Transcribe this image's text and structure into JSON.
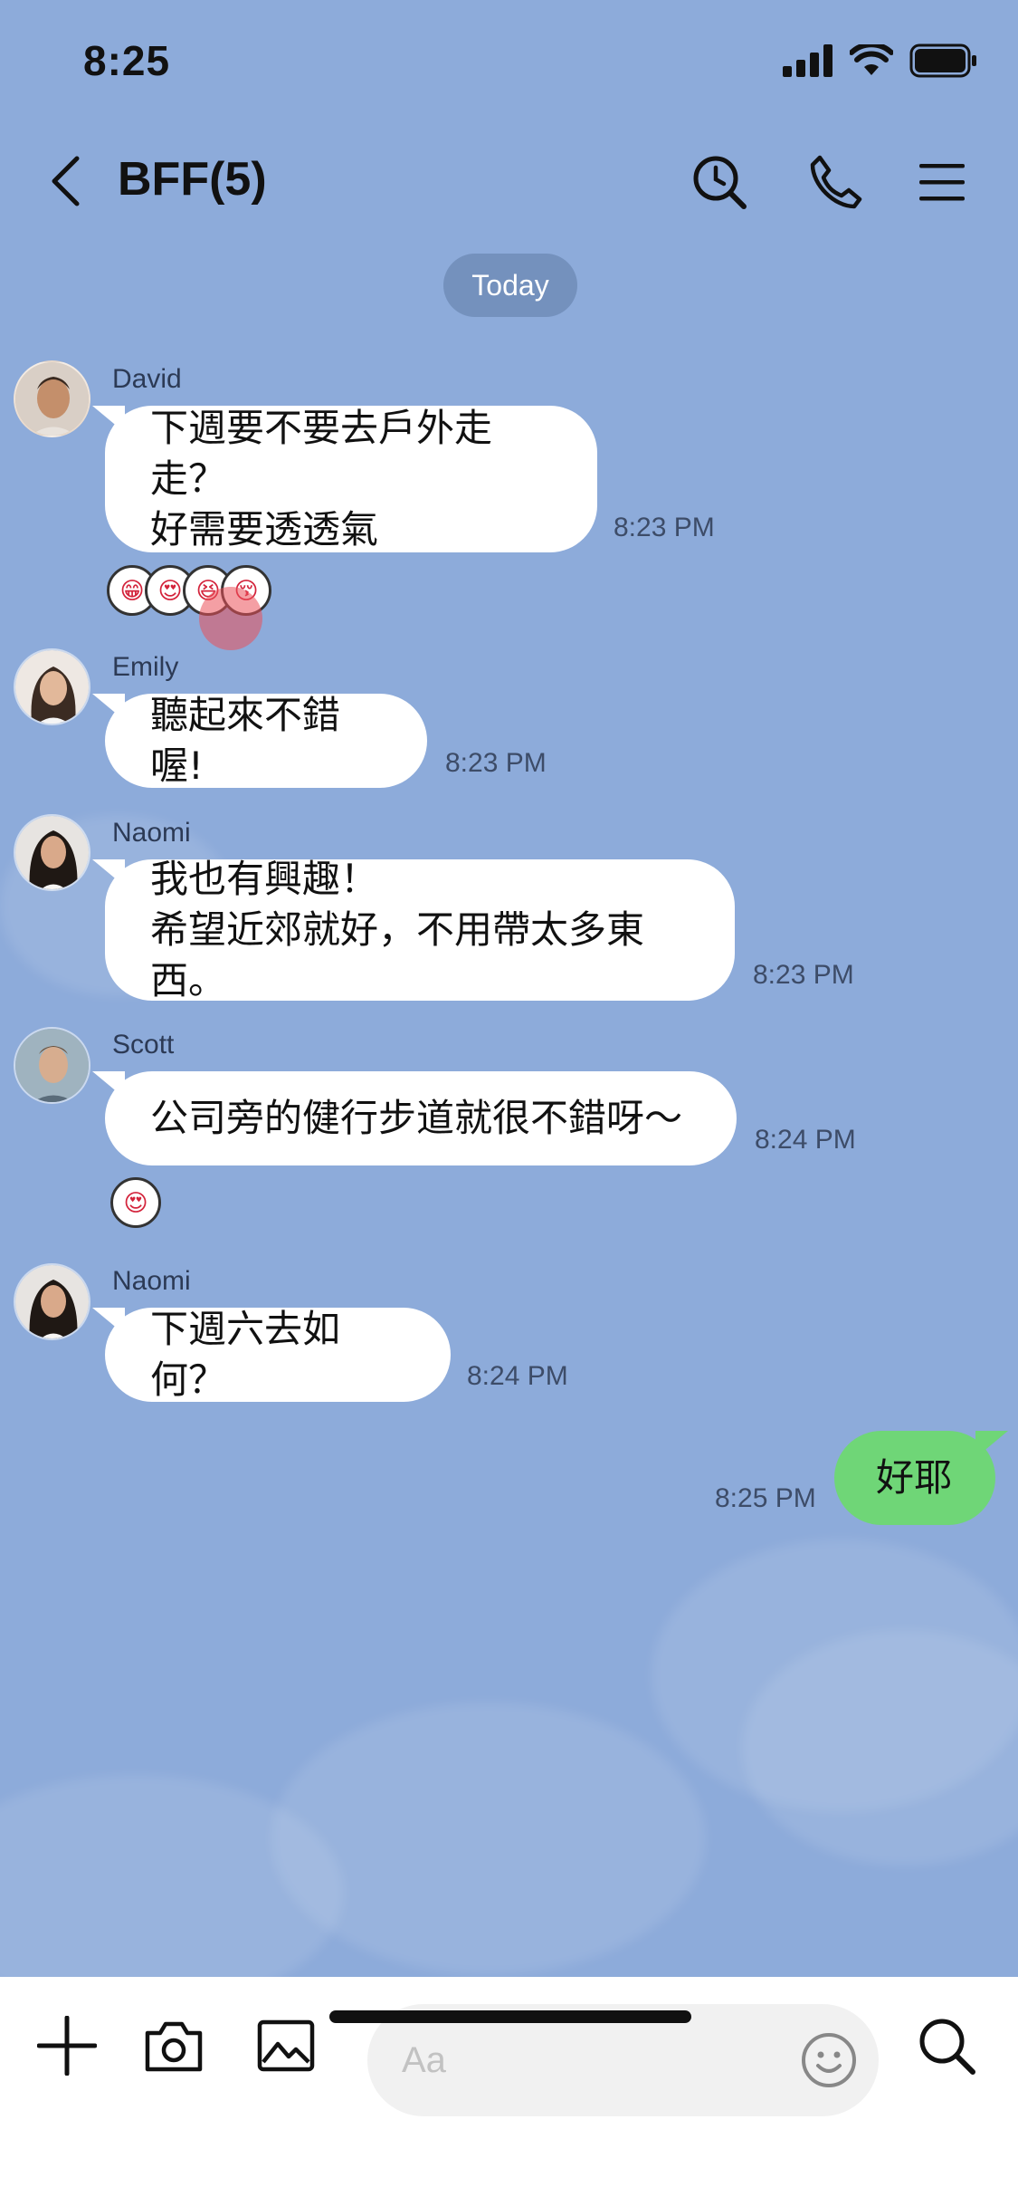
{
  "status": {
    "time": "8:25"
  },
  "header": {
    "title": "BFF(5)",
    "icons": [
      "back-icon",
      "search-history-icon",
      "phone-icon",
      "menu-icon"
    ]
  },
  "date_chip": "Today",
  "messages": [
    {
      "sender": "David",
      "lines": [
        "下週要不要去戶外走走？",
        "好需要透透氣"
      ],
      "time": "8:23 PM",
      "reactions": [
        "😁",
        "😍",
        "😆",
        "😚"
      ]
    },
    {
      "sender": "Emily",
      "lines": [
        "聽起來不錯喔!"
      ],
      "time": "8:23 PM"
    },
    {
      "sender": "Naomi",
      "lines": [
        "我也有興趣！",
        "希望近郊就好，不用帶太多東西。"
      ],
      "time": "8:23 PM"
    },
    {
      "sender": "Scott",
      "lines": [
        "公司旁的健行步道就很不錯呀～"
      ],
      "time": "8:24 PM",
      "reactions": [
        "😍"
      ]
    },
    {
      "sender": "Naomi",
      "lines": [
        "下週六去如何？"
      ],
      "time": "8:24 PM"
    }
  ],
  "my_message": {
    "text": "好耶",
    "time": "8:25 PM"
  },
  "input": {
    "placeholder": "Aa"
  },
  "colors": {
    "background": "#8dabda",
    "my_bubble": "#6fd677",
    "other_bubble": "#ffffff"
  }
}
